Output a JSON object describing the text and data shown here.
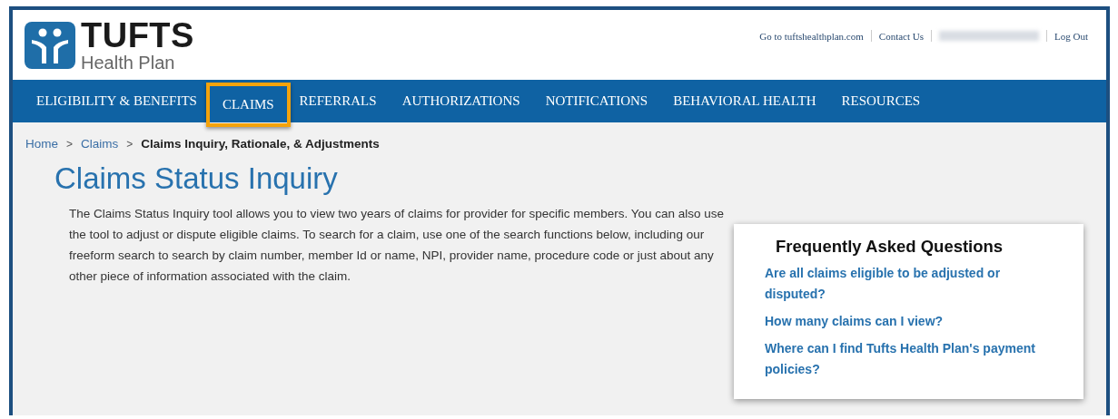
{
  "logo": {
    "title": "TUFTS",
    "subtitle": "Health Plan"
  },
  "top_links": [
    {
      "kind": "link",
      "label": "Go to tuftshealthplan.com"
    },
    {
      "kind": "link",
      "label": "Contact Us"
    },
    {
      "kind": "blurred"
    },
    {
      "kind": "link",
      "label": "Log Out"
    }
  ],
  "nav": [
    {
      "label": "ELIGIBILITY & BENEFITS",
      "highlighted": false
    },
    {
      "label": "CLAIMS",
      "highlighted": true
    },
    {
      "label": "REFERRALS",
      "highlighted": false
    },
    {
      "label": "AUTHORIZATIONS",
      "highlighted": false
    },
    {
      "label": "NOTIFICATIONS",
      "highlighted": false
    },
    {
      "label": "BEHAVIORAL HEALTH",
      "highlighted": false
    },
    {
      "label": "RESOURCES",
      "highlighted": false
    }
  ],
  "breadcrumb": [
    {
      "label": "Home",
      "current": false
    },
    {
      "label": "Claims",
      "current": false
    },
    {
      "label": "Claims Inquiry, Rationale, & Adjustments",
      "current": true
    }
  ],
  "breadcrumb_separator": ">",
  "page_title": "Claims Status Inquiry",
  "intro": "The Claims Status Inquiry tool allows you to view two years of claims for provider for specific members. You can also use the tool to adjust or dispute eligible claims. To search for a claim, use one of the search functions below, including our freeform search to search by claim number, member Id or name, NPI, provider name, procedure code or just about any other piece of information associated with the claim.",
  "faq": {
    "title": "Frequently Asked Questions",
    "questions": [
      "Are all claims eligible to be adjusted or disputed?",
      "How many claims can I view?",
      "Where can I find Tufts Health Plan's payment policies?"
    ]
  }
}
